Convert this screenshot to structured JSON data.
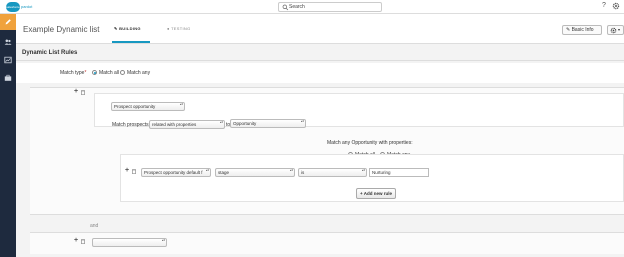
{
  "header": {
    "logo_text": "pardot",
    "logo_cloud_text": "salesforce",
    "search_placeholder": "Search",
    "help_label": "?"
  },
  "page": {
    "title": "Example Dynamic list",
    "tabs": [
      {
        "label": "BUILDING",
        "active": true
      },
      {
        "label": "TESTING",
        "active": false
      }
    ],
    "basic_info_label": "Basic Info"
  },
  "rules": {
    "section_title": "Dynamic List Rules",
    "match_type_label": "Match type",
    "match_all_label": "Match all",
    "match_any_label": "Match any",
    "match_type_selected": "Match all",
    "rule1": {
      "object_select": "Prospect opportunity",
      "match_prospects_label": "Match prospects",
      "relation_select": "related with properties",
      "to_label": "to",
      "target_select": "Opportunity",
      "sub_heading": "Match any Opportunity with properties:",
      "sub_match_all_label": "Match all",
      "sub_match_any_label": "Match any",
      "sub_match_selected": "Match all",
      "condition": {
        "field_select": "Prospect opportunity default f",
        "property_select": "stage",
        "operator_select": "is",
        "value": "Nurturing"
      },
      "add_rule_label": "+ Add new rule"
    },
    "and_label": "and",
    "rule2": {
      "object_select": ""
    }
  },
  "colors": {
    "accent": "#1798c1",
    "sidebar": "#1e2a3e",
    "sidebar_active": "#f0a23c"
  }
}
